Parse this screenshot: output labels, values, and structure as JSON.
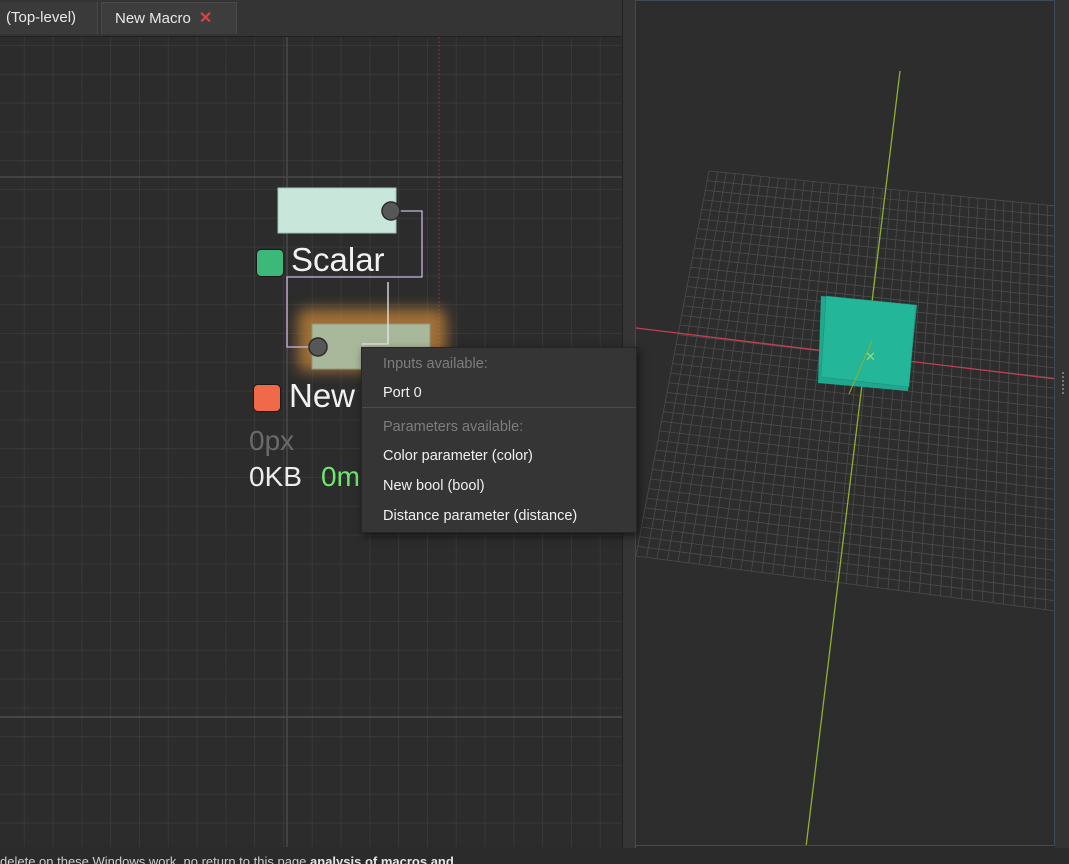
{
  "tabs": [
    {
      "label": "(Top-level)",
      "closable": false
    },
    {
      "label": "New Macro",
      "closable": true,
      "close_glyph": "✕"
    }
  ],
  "graph": {
    "nodes": [
      {
        "label": "Scalar",
        "indicator_color": "#3cb878",
        "body_color": "#c8e6da"
      },
      {
        "label": "New",
        "indicator_color": "#f06a4a",
        "body_color": "#a9b89a"
      }
    ],
    "stats": {
      "pixels": "0px",
      "memory": "0KB",
      "time": "0m"
    },
    "link_color": "#c9b4e0",
    "selection_glow": "#c9873a"
  },
  "context_menu": {
    "inputs_header": "Inputs available:",
    "inputs": [
      "Port 0"
    ],
    "params_header": "Parameters available:",
    "params": [
      "Color parameter (color)",
      "New bool (bool)",
      "Distance parameter (distance)"
    ]
  },
  "viewport": {
    "object": "cube",
    "object_color": "#1fa88e",
    "x_axis_color": "#c04050",
    "y_axis_color": "#8fb030"
  },
  "status_bar": {
    "text": "delete on these Windows work, no return to this page",
    "bold": "analysis of macros and"
  }
}
